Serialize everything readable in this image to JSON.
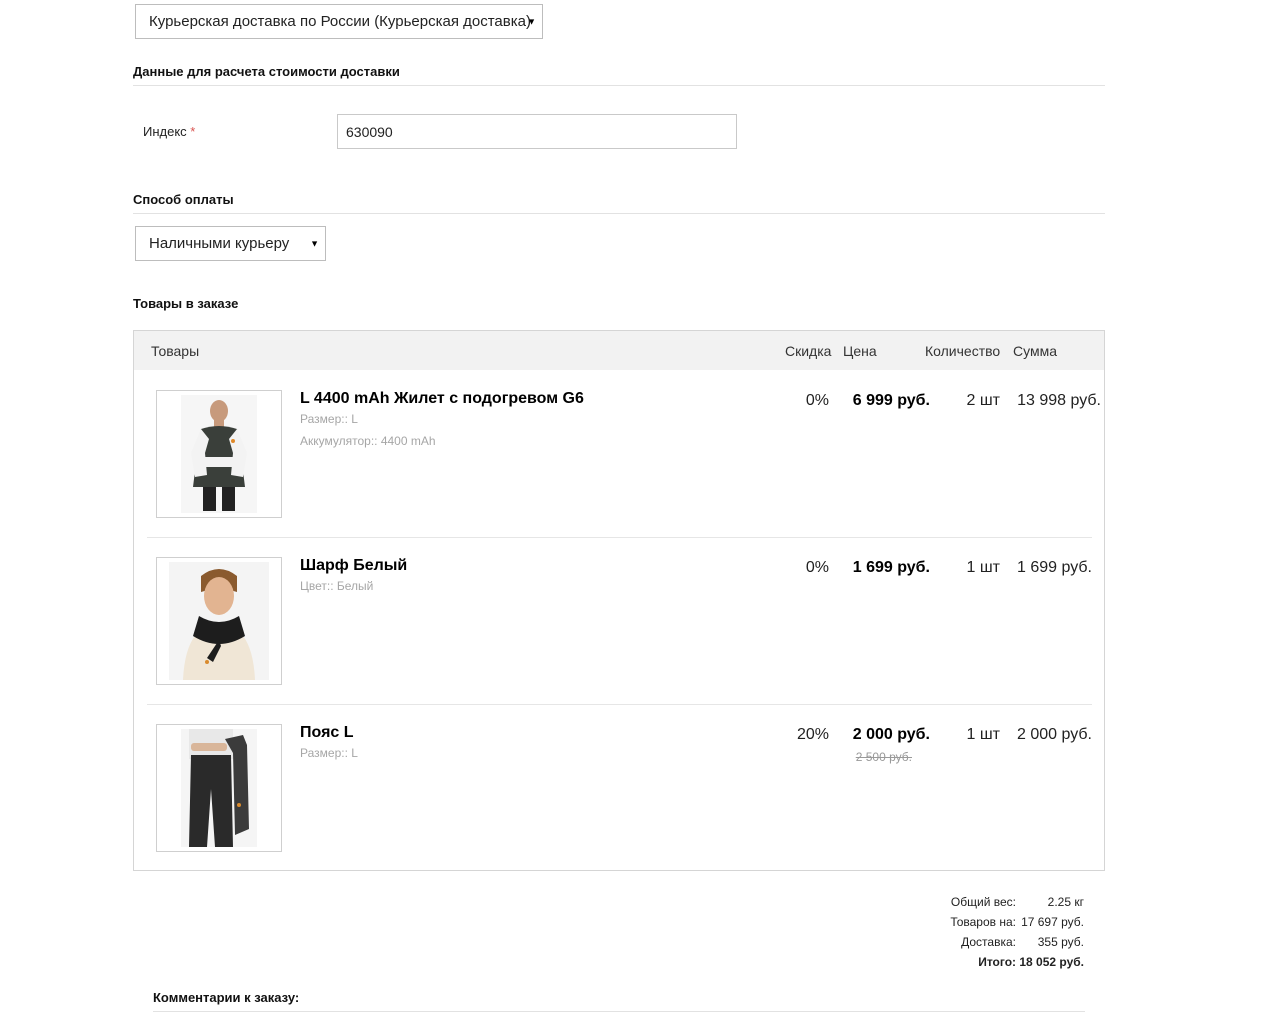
{
  "delivery": {
    "selected": "Курьерская доставка по России (Курьерская доставка)"
  },
  "calc_section": {
    "title": "Данные для расчета стоимости доставки",
    "index_label": "Индекс",
    "required_mark": "*",
    "index_value": "630090"
  },
  "payment": {
    "title": "Способ оплаты",
    "selected": "Наличными курьеру"
  },
  "order": {
    "title": "Товары в заказе",
    "columns": {
      "products": "Товары",
      "discount": "Скидка",
      "price": "Цена",
      "quantity": "Количество",
      "sum": "Сумма"
    },
    "items": [
      {
        "name": "L 4400 mAh Жилет с подогревом G6",
        "props": [
          "Размер:: L",
          "Аккумулятор:: 4400 mAh"
        ],
        "discount": "0%",
        "price": "6 999 руб.",
        "qty": "2 шт",
        "sum": "13 998 руб."
      },
      {
        "name": "Шарф Белый",
        "props": [
          "Цвет:: Белый"
        ],
        "discount": "0%",
        "price": "1 699 руб.",
        "qty": "1 шт",
        "sum": "1 699 руб."
      },
      {
        "name": "Пояс L",
        "props": [
          "Размер:: L"
        ],
        "discount": "20%",
        "price": "2 000 руб.",
        "old_price": "2 500 руб.",
        "qty": "1 шт",
        "sum": "2 000 руб."
      }
    ]
  },
  "totals": {
    "weight_label": "Общий вес:",
    "weight_value": "2.25 кг",
    "goods_label": "Товаров на:",
    "goods_value": "17 697 руб.",
    "delivery_label": "Доставка:",
    "delivery_value": "355 руб.",
    "total": "Итого: 18 052 руб."
  },
  "comments": {
    "title": "Комментарии к заказу:"
  }
}
